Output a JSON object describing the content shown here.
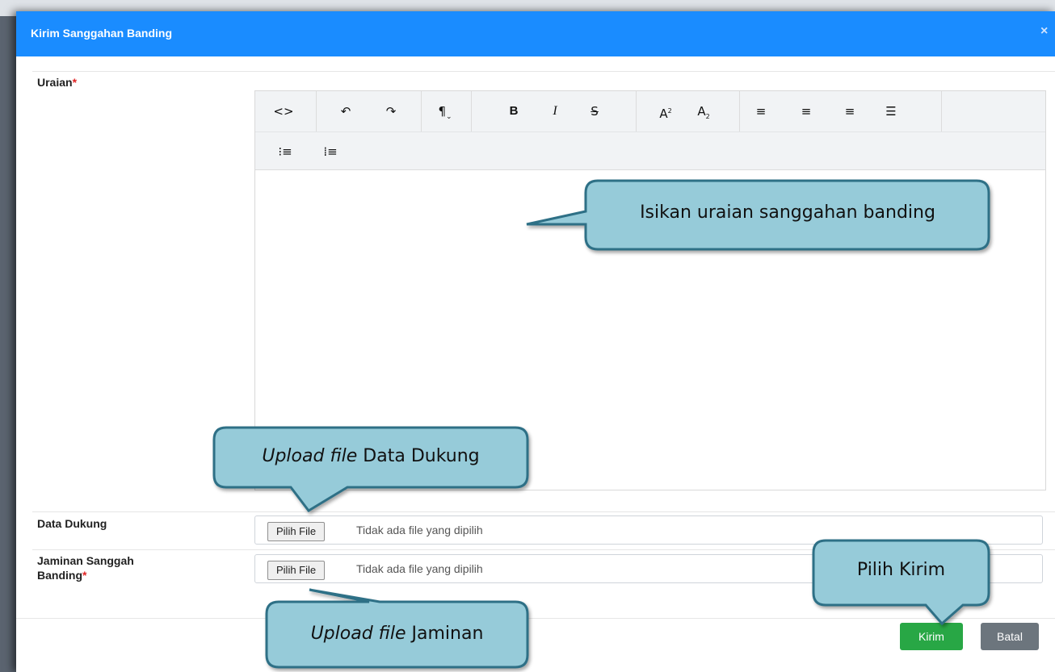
{
  "modal": {
    "title": "Kirim Sanggahan Banding",
    "close_glyph": "×"
  },
  "form": {
    "uraian_label": "Uraian",
    "required_mark": "*",
    "data_dukung_label": "Data Dukung",
    "jaminan_label_line1": "Jaminan Sanggah",
    "jaminan_label_line2": "Banding",
    "file_button": "Pilih File",
    "file_placeholder": "Tidak ada file yang dipilih"
  },
  "toolbar": {
    "icons": [
      "code-view-icon",
      "undo-icon",
      "redo-icon",
      "paragraph-format-icon",
      "bold-icon",
      "italic-icon",
      "strikethrough-icon",
      "superscript-icon",
      "subscript-icon",
      "align-left-icon",
      "align-center-icon",
      "align-right-icon",
      "align-justify-icon",
      "bulleted-list-icon",
      "numbered-list-icon"
    ]
  },
  "footer": {
    "kirim_label": "Kirim",
    "batal_label": "Batal",
    "kirim_color": "#28a745",
    "batal_color": "#6c757d"
  },
  "callouts": {
    "uraian": "Isikan uraian sanggahan banding",
    "data_dukung_italic": "Upload file",
    "data_dukung_rest": " Data Dukung",
    "jaminan_italic": "Upload file",
    "jaminan_rest": " Jaminan",
    "kirim": "Pilih Kirim",
    "fill_color": "#96cbd9",
    "border_color": "#2d6f86"
  },
  "colors": {
    "header_blue": "#1a8cff"
  }
}
